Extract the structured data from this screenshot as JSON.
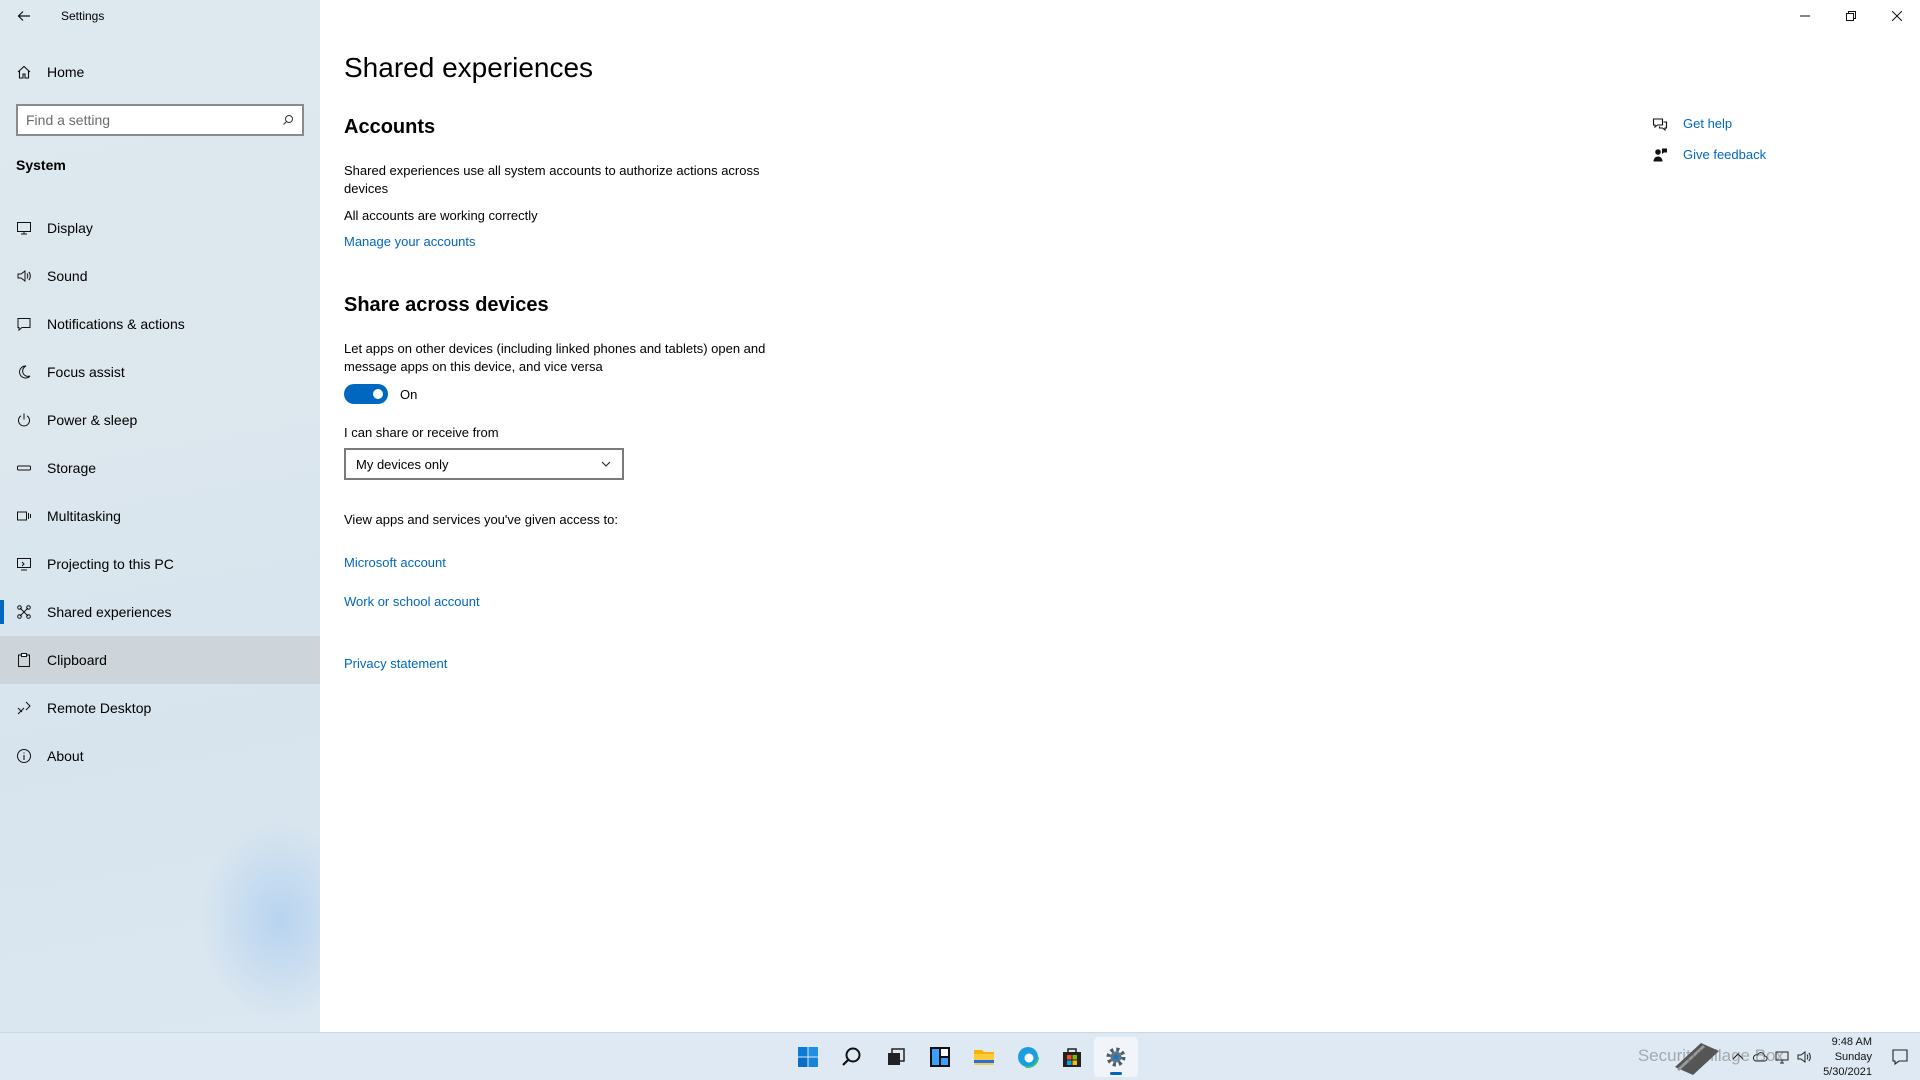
{
  "window": {
    "app_title": "Settings"
  },
  "sidebar": {
    "home_label": "Home",
    "search_placeholder": "Find a setting",
    "section_title": "System",
    "items": [
      {
        "label": "Display",
        "icon": "monitor-icon"
      },
      {
        "label": "Sound",
        "icon": "speaker-icon"
      },
      {
        "label": "Notifications & actions",
        "icon": "message-icon"
      },
      {
        "label": "Focus assist",
        "icon": "moon-icon"
      },
      {
        "label": "Power & sleep",
        "icon": "power-icon"
      },
      {
        "label": "Storage",
        "icon": "storage-icon"
      },
      {
        "label": "Multitasking",
        "icon": "multitask-icon"
      },
      {
        "label": "Projecting to this PC",
        "icon": "project-icon"
      },
      {
        "label": "Shared experiences",
        "icon": "share-icon"
      },
      {
        "label": "Clipboard",
        "icon": "clipboard-icon"
      },
      {
        "label": "Remote Desktop",
        "icon": "remote-icon"
      },
      {
        "label": "About",
        "icon": "info-icon"
      }
    ],
    "selected": "Shared experiences",
    "hovered": "Clipboard"
  },
  "main": {
    "page_title": "Shared experiences",
    "accounts": {
      "heading": "Accounts",
      "description": "Shared experiences use all system accounts to authorize actions across devices",
      "status": "All accounts are working correctly",
      "link": "Manage your accounts"
    },
    "share": {
      "heading": "Share across devices",
      "description": "Let apps on other devices (including linked phones and tablets) open and message apps on this device, and vice versa",
      "toggle_state": "On",
      "dropdown_label": "I can share or receive from",
      "dropdown_value": "My devices only",
      "access_label": "View apps and services you've given access to:",
      "link_microsoft": "Microsoft account",
      "link_work": "Work or school account",
      "link_privacy": "Privacy statement"
    },
    "help": {
      "get_help": "Get help",
      "give_feedback": "Give feedback"
    }
  },
  "taskbar": {
    "time": "9:48 AM",
    "day": "Sunday",
    "date": "5/30/2021",
    "watermark": "SecurityVillage Box"
  },
  "colors": {
    "accent": "#0067c0",
    "sidebar_bg": "#dce7ee",
    "hover_bg": "#cdd5db"
  }
}
